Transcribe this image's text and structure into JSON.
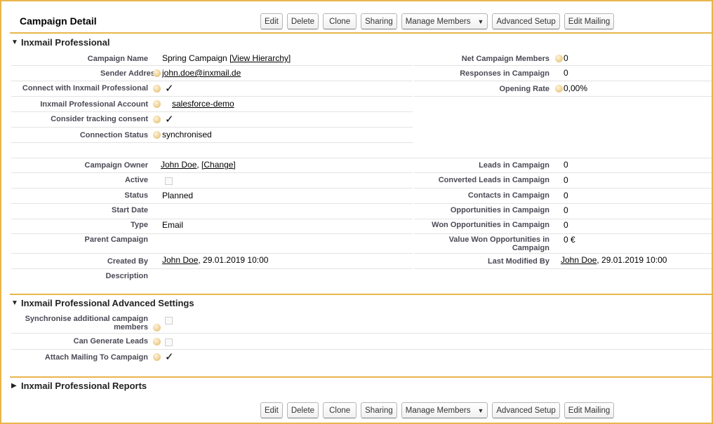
{
  "page_title": "Campaign Detail",
  "buttons": {
    "edit": "Edit",
    "delete": "Delete",
    "clone": "Clone",
    "sharing": "Sharing",
    "manage_members": "Manage Members",
    "advanced_setup": "Advanced Setup",
    "edit_mailing": "Edit Mailing"
  },
  "sections": {
    "inxmail": "Inxmail Professional",
    "advanced": "Inxmail Professional Advanced Settings",
    "reports": "Inxmail Professional Reports"
  },
  "fields": {
    "campaign_name_label": "Campaign Name",
    "campaign_name_value": "Spring Campaign",
    "view_hierarchy": "[View Hierarchy]",
    "sender_address_label": "Sender Address",
    "sender_address_value": "john.doe@inxmail.de",
    "connect_label": "Connect with Inxmail Professional",
    "account_label": "Inxmail Professional Account",
    "account_value": "salesforce-demo",
    "tracking_label": "Consider tracking consent",
    "connection_label": "Connection Status",
    "connection_value": "synchronised",
    "net_members_label": "Net Campaign Members",
    "net_members_value": "0",
    "responses_label": "Responses in Campaign",
    "responses_value": "0",
    "opening_label": "Opening Rate",
    "opening_value": "0,00%",
    "owner_label": "Campaign Owner",
    "owner_value": "John Doe",
    "owner_change": "[Change]",
    "active_label": "Active",
    "status_label": "Status",
    "status_value": "Planned",
    "start_date_label": "Start Date",
    "type_label": "Type",
    "type_value": "Email",
    "parent_label": "Parent Campaign",
    "created_label": "Created By",
    "created_user": "John Doe",
    "created_date": ", 29.01.2019 10:00",
    "description_label": "Description",
    "leads_label": "Leads in Campaign",
    "leads_value": "0",
    "converted_label": "Converted Leads in Campaign",
    "converted_value": "0",
    "contacts_label": "Contacts in Campaign",
    "contacts_value": "0",
    "opps_label": "Opportunities in Campaign",
    "opps_value": "0",
    "won_opps_label": "Won Opportunities in Campaign",
    "won_opps_value": "0",
    "value_won_label": "Value Won Opportunities in Campaign",
    "value_won_value": "0 €",
    "modified_label": "Last Modified By",
    "modified_user": "John Doe",
    "modified_date": ", 29.01.2019 10:00",
    "sync_label": "Synchronise additional campaign members",
    "generate_label": "Can Generate Leads",
    "attach_label": "Attach Mailing To Campaign"
  },
  "check_glyph": "✓",
  "icons": {
    "help": "help-icon",
    "collapse": "triangle-down-icon",
    "expand": "triangle-right-icon",
    "dropdown": "chevron-down-icon"
  },
  "colors": {
    "accent": "#e8b64b",
    "label": "#4a4a56"
  }
}
